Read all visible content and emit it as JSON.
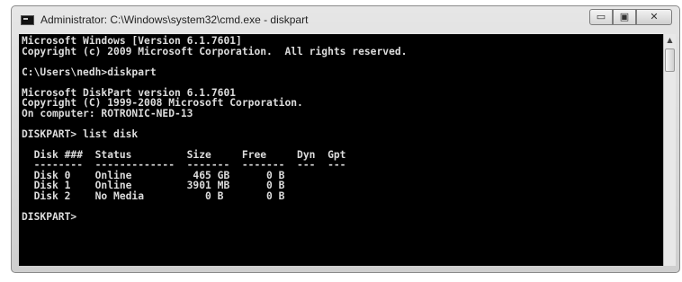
{
  "window": {
    "title": "Administrator: C:\\Windows\\system32\\cmd.exe - diskpart",
    "minimize_glyph": "▭",
    "maximize_glyph": "▣",
    "close_glyph": "✕"
  },
  "console_lines": [
    "Microsoft Windows [Version 6.1.7601]",
    "Copyright (c) 2009 Microsoft Corporation.  All rights reserved.",
    "",
    "C:\\Users\\nedh>diskpart",
    "",
    "Microsoft DiskPart version 6.1.7601",
    "Copyright (C) 1999-2008 Microsoft Corporation.",
    "On computer: ROTRONIC-NED-13",
    "",
    "DISKPART> list disk",
    "",
    "  Disk ###  Status         Size     Free     Dyn  Gpt",
    "  --------  -------------  -------  -------  ---  ---",
    "  Disk 0    Online          465 GB      0 B",
    "  Disk 1    Online         3901 MB      0 B",
    "  Disk 2    No Media          0 B       0 B",
    "",
    "DISKPART>"
  ],
  "scrollbar": {
    "up_glyph": "▲"
  }
}
